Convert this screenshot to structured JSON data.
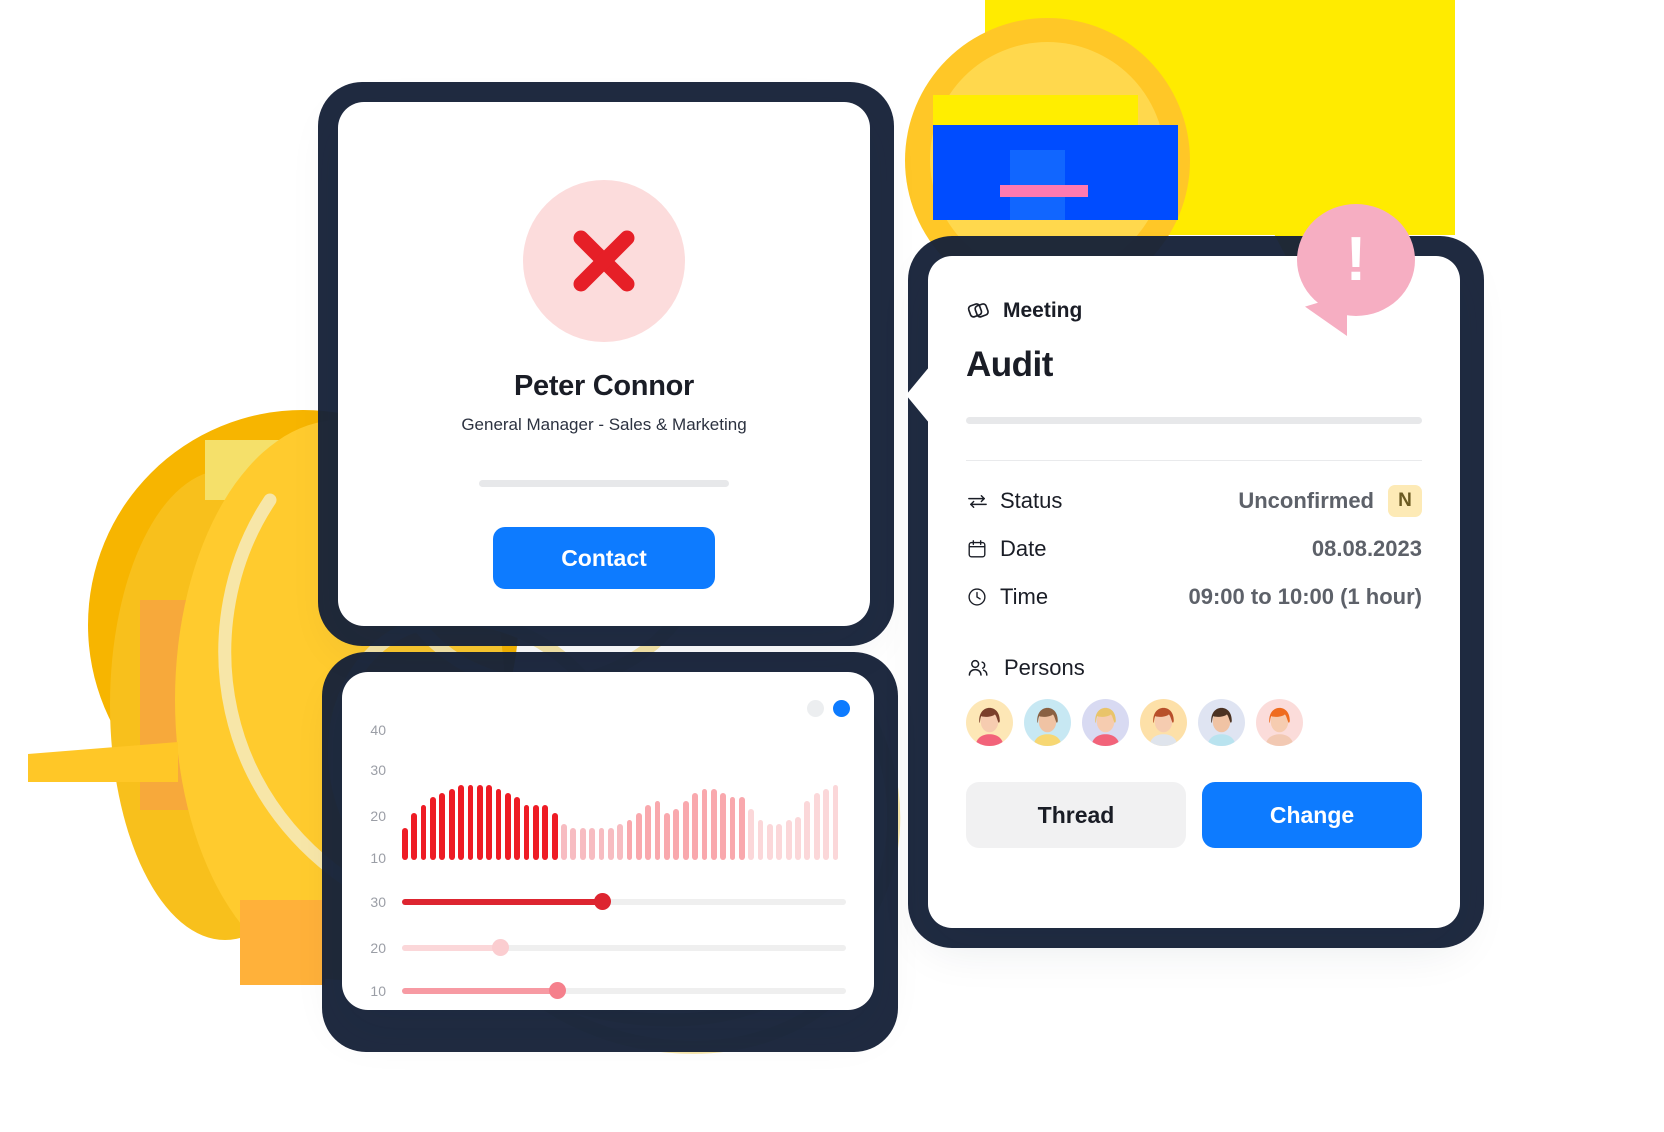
{
  "person_card": {
    "status_icon": "red-x-icon",
    "name": "Peter Connor",
    "role": "General Manager - Sales & Marketing",
    "contact_label": "Contact",
    "accent_color": "#0d7bff",
    "x_color": "#e61f27",
    "x_bg_color": "#fcdcdc"
  },
  "meeting_card": {
    "kicker_icon": "handshake-icon",
    "kicker": "Meeting",
    "title": "Audit",
    "alert_badge": "!",
    "alert_color": "#f6aec2",
    "fields": [
      {
        "icon": "arrows-exchange-icon",
        "label": "Status",
        "value": "Unconfirmed",
        "badge": "N",
        "badge_color": "#fdeab6"
      },
      {
        "icon": "calendar-icon",
        "label": "Date",
        "value": "08.08.2023",
        "badge": "",
        "badge_color": ""
      },
      {
        "icon": "clock-icon",
        "label": "Time",
        "value": "09:00 to 10:00 (1 hour)",
        "badge": "",
        "badge_color": ""
      }
    ],
    "persons_icon": "people-icon",
    "persons_label": "Persons",
    "persons": [
      {
        "name": "avatar-1",
        "bg": "#fde7b6",
        "hair": "#7a3f2b",
        "skin": "#f6ccb0",
        "shirt": "#f2637a"
      },
      {
        "name": "avatar-2",
        "bg": "#c7e8f3",
        "hair": "#8a6143",
        "skin": "#f0c3a4",
        "shirt": "#f7d773"
      },
      {
        "name": "avatar-3",
        "bg": "#d8daf2",
        "hair": "#e9c46a",
        "skin": "#f6ccb0",
        "shirt": "#f2637a"
      },
      {
        "name": "avatar-4",
        "bg": "#fde0a8",
        "hair": "#b8502a",
        "skin": "#f6ccb0",
        "shirt": "#dfe4ec"
      },
      {
        "name": "avatar-5",
        "bg": "#dfe4f2",
        "hair": "#4b3222",
        "skin": "#f0c3a4",
        "shirt": "#b9e3ef"
      },
      {
        "name": "avatar-6",
        "bg": "#fbdcda",
        "hair": "#ef6c1f",
        "skin": "#f6ccb0",
        "shirt": "#f2c9b3"
      }
    ],
    "thread_label": "Thread",
    "change_label": "Change",
    "thread_color": "#f1f1f2",
    "change_color": "#0d7bff"
  },
  "chart_card": {
    "toggle_off_label": "toggle-inactive",
    "toggle_on_label": "toggle-active"
  },
  "chart_data": {
    "type": "bar",
    "title": "",
    "xlabel": "",
    "ylabel": "",
    "ylim": [
      0,
      45
    ],
    "yticks": [
      40,
      30,
      20,
      10
    ],
    "grid": false,
    "legend": "none",
    "bar_colors": [
      "#ee1c25",
      "#f9a8ad",
      "#f7bcc1",
      "#fbd7d9"
    ],
    "values": [
      8,
      12,
      14,
      16,
      17,
      18,
      19,
      19,
      19,
      19,
      18,
      17,
      16,
      14,
      14,
      14,
      12,
      9,
      8,
      8,
      8,
      8,
      8,
      9,
      10,
      12,
      14,
      15,
      12,
      13,
      15,
      17,
      18,
      18,
      17,
      16,
      16,
      13,
      10,
      9,
      9,
      10,
      11,
      15,
      17,
      18,
      19
    ],
    "series": [
      {
        "name": "solid-red",
        "values": [
          8,
          12,
          14,
          16,
          17,
          18,
          19,
          19,
          19,
          19,
          18,
          17,
          16,
          14,
          14,
          14,
          12
        ]
      },
      {
        "name": "light-pink",
        "values": [
          9,
          8,
          8,
          8,
          8,
          8,
          9,
          10,
          12,
          14,
          15,
          12,
          13,
          15,
          17,
          18,
          18,
          17,
          16,
          16
        ]
      },
      {
        "name": "pale-pink",
        "values": [
          13,
          10,
          9,
          9,
          10,
          11,
          15,
          17,
          18,
          19
        ]
      }
    ]
  },
  "sliders": [
    {
      "label": "30",
      "value": 45,
      "fill_color": "#dd2530",
      "thumb_color": "#dd2530"
    },
    {
      "label": "20",
      "value": 22,
      "fill_color": "#fbd7d9",
      "thumb_color": "#fbcdd0"
    },
    {
      "label": "10",
      "value": 35,
      "fill_color": "#f79aa3",
      "thumb_color": "#f5808c"
    }
  ]
}
